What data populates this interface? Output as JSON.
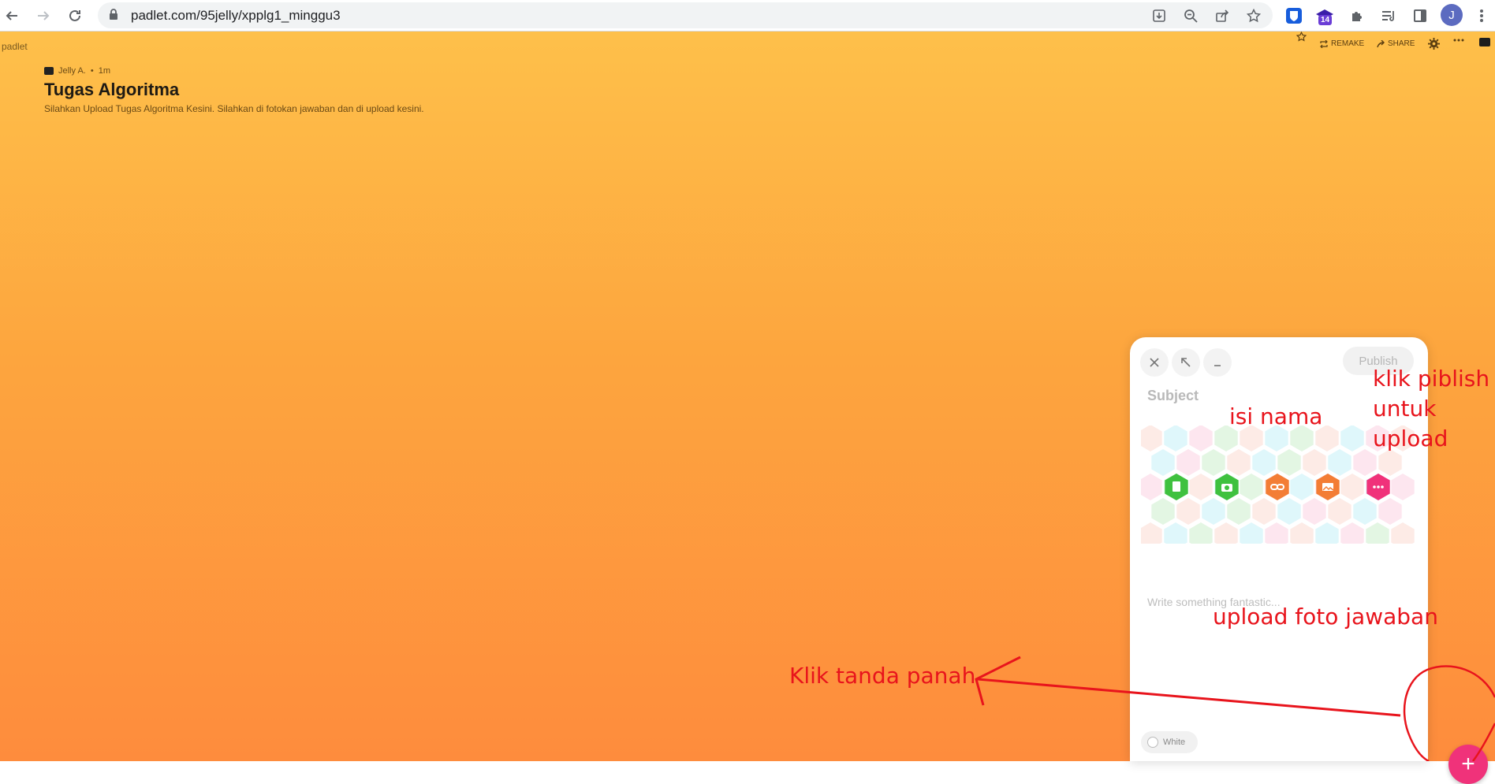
{
  "browser": {
    "url": "padlet.com/95jelly/xpplg1_minggu3",
    "extension_badge": "14",
    "profile_initial": "J"
  },
  "padlet": {
    "brand": "padlet",
    "actions": {
      "remake": "REMAKE",
      "share": "SHARE"
    },
    "author": {
      "name": "Jelly A.",
      "time": "1m"
    },
    "title": "Tugas Algoritma",
    "description": "Silahkan Upload Tugas Algoritma Kesini. Silahkan di fotokan jawaban dan di upload kesini."
  },
  "composer": {
    "publish_label": "Publish",
    "subject_placeholder": "Subject",
    "body_placeholder": "Write something fantastic...",
    "color_label": "White",
    "attachments": [
      {
        "icon": "file-upload-icon",
        "color": "#3fc13f"
      },
      {
        "icon": "camera-icon",
        "color": "#3fc13f"
      },
      {
        "icon": "link-icon",
        "color": "#f37d35"
      },
      {
        "icon": "image-search-icon",
        "color": "#f37d35"
      },
      {
        "icon": "more-icon",
        "color": "#f0327a"
      }
    ],
    "fab_symbol": "+"
  },
  "annotations": {
    "publish_note_1": "klik piblish",
    "publish_note_2": "untuk",
    "publish_note_3": "upload",
    "name_note": "isi nama",
    "upload_note": "upload foto jawaban",
    "arrow_note": "Klik tanda panah"
  },
  "colors": {
    "gradient_top": "#fec04a",
    "gradient_bottom": "#fe8c3d",
    "annotation": "#e8141c",
    "fab": "#f0327a"
  }
}
